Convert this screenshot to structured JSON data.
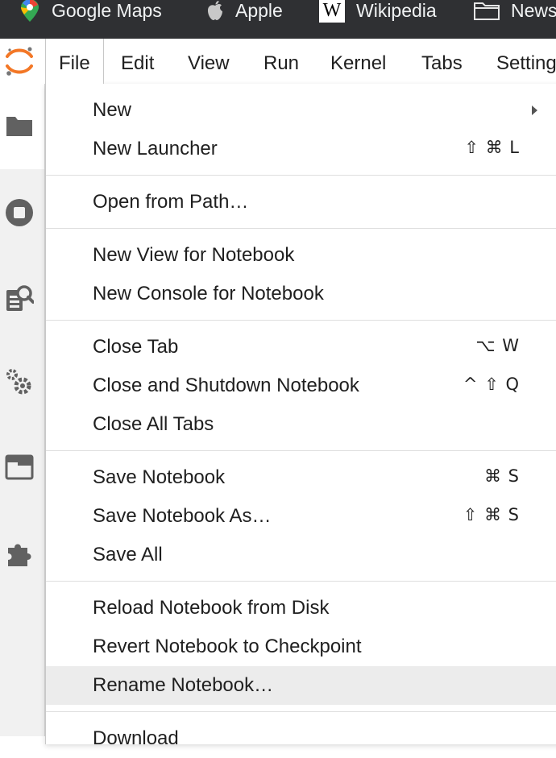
{
  "bookmarks": [
    {
      "icon": "google-maps-icon",
      "label": "Google Maps"
    },
    {
      "icon": "apple-icon",
      "label": "Apple"
    },
    {
      "icon": "wikipedia-icon",
      "label": "Wikipedia",
      "icon_text": "W"
    },
    {
      "icon": "folder-icon",
      "label": "News"
    }
  ],
  "menubar": {
    "items": [
      "File",
      "Edit",
      "View",
      "Run",
      "Kernel",
      "Tabs",
      "Settings"
    ]
  },
  "sidebar": {
    "icons": [
      "folder-icon",
      "stop-circle-icon",
      "property-inspector-icon",
      "gears-icon",
      "tabs-icon",
      "extension-puzzle-icon"
    ]
  },
  "file_menu": {
    "items": [
      {
        "label": "New",
        "shortcut": "",
        "submenu": true
      },
      {
        "label": "New Launcher",
        "shortcut": "⇧ ⌘ L"
      },
      {
        "label": "Open from Path…",
        "shortcut": ""
      },
      {
        "label": "New View for Notebook",
        "shortcut": ""
      },
      {
        "label": "New Console for Notebook",
        "shortcut": ""
      },
      {
        "label": "Close Tab",
        "shortcut": "⌥ W"
      },
      {
        "label": "Close and Shutdown Notebook",
        "shortcut": "^ ⇧ Q"
      },
      {
        "label": "Close All Tabs",
        "shortcut": ""
      },
      {
        "label": "Save Notebook",
        "shortcut": "⌘ S"
      },
      {
        "label": "Save Notebook As…",
        "shortcut": "⇧ ⌘ S"
      },
      {
        "label": "Save All",
        "shortcut": ""
      },
      {
        "label": "Reload Notebook from Disk",
        "shortcut": ""
      },
      {
        "label": "Revert Notebook to Checkpoint",
        "shortcut": ""
      },
      {
        "label": "Rename Notebook…",
        "shortcut": "",
        "highlighted": true
      },
      {
        "label": "Download",
        "shortcut": ""
      }
    ]
  },
  "colors": {
    "bookmarks_bg": "#2f3033",
    "highlight": "#ececec",
    "jupyter_orange": "#f37726"
  }
}
